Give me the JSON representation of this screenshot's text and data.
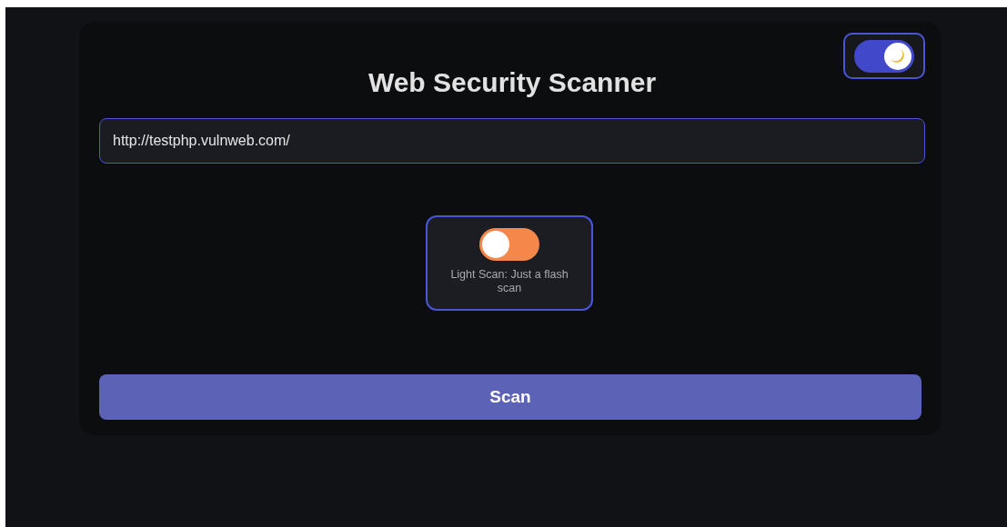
{
  "theme_toggle": {
    "on": true
  },
  "title": "Web Security Scanner",
  "url_field": {
    "value": "http://testphp.vulnweb.com/"
  },
  "scan_mode": {
    "on": false,
    "label": "Light Scan: Just a flash scan"
  },
  "scan_button": "Scan"
}
